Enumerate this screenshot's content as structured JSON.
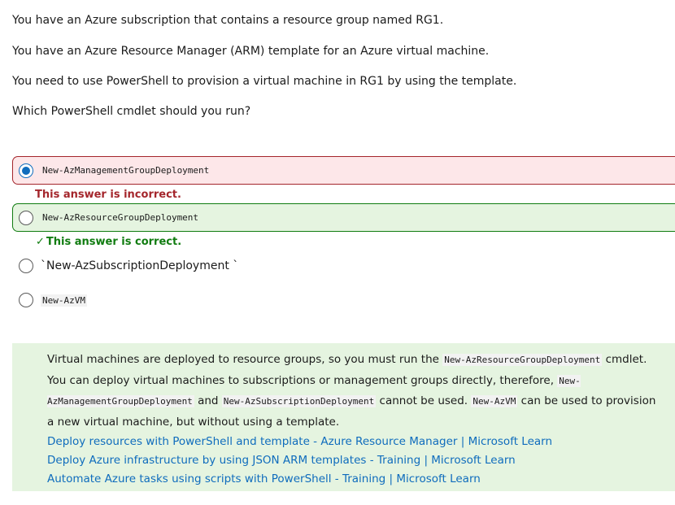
{
  "question": {
    "lines": [
      "You have an Azure subscription that contains a resource group named RG1.",
      "You have an Azure Resource Manager (ARM) template for an Azure virtual machine.",
      "You need to use PowerShell to provision a virtual machine in RG1 by using the template.",
      "Which PowerShell cmdlet should you run?"
    ]
  },
  "options": [
    {
      "label": "New-AzManagementGroupDeployment",
      "selected": true,
      "state": "incorrect"
    },
    {
      "label": "New-AzResourceGroupDeployment",
      "selected": false,
      "state": "correct"
    },
    {
      "label": "`New-AzSubscriptionDeployment `",
      "selected": false,
      "state": "none"
    },
    {
      "label": "New-AzVM",
      "selected": false,
      "state": "none"
    }
  ],
  "feedback": {
    "incorrect": "This answer is incorrect.",
    "correct": "This answer is correct."
  },
  "explanation": {
    "t1": "Virtual machines are deployed to resource groups, so you must run the ",
    "c1": "New-AzResourceGroupDeployment",
    "t2": " cmdlet. You can deploy virtual machines to subscriptions or management groups directly, therefore, ",
    "c2": "New-AzManagementGroupDeployment",
    "t3": " and ",
    "c3": "New-AzSubscriptionDeployment",
    "t4": " cannot be used. ",
    "c4": "New-AzVM",
    "t5": " can be used to provision a new virtual machine, but without using a template."
  },
  "links": [
    "Deploy resources with PowerShell and template - Azure Resource Manager | Microsoft Learn",
    "Deploy Azure infrastructure by using JSON ARM templates - Training | Microsoft Learn",
    "Automate Azure tasks using scripts with PowerShell - Training | Microsoft Learn"
  ],
  "colors": {
    "incorrect_bg": "#fde7e9",
    "incorrect_border": "#a4262c",
    "correct_bg": "#e5f4e0",
    "correct_border": "#107c10",
    "link": "#0f6cbd",
    "radio_selected": "#0f6cbd"
  }
}
